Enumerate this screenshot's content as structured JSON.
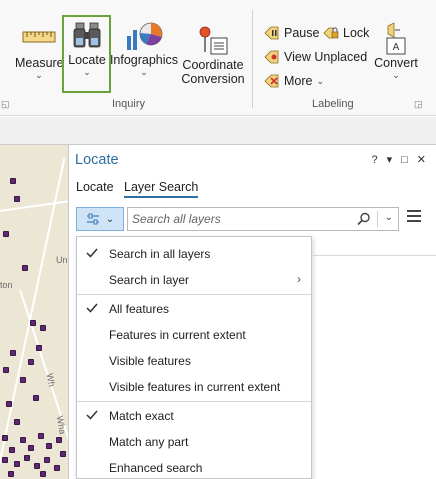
{
  "ribbon": {
    "inquiry": {
      "buttons": [
        {
          "label": "Measure",
          "icon": "ruler-icon"
        },
        {
          "label": "Locate",
          "icon": "binoculars-icon"
        },
        {
          "label": "Infographics",
          "icon": "pie-chart-icon"
        },
        {
          "label_line1": "Coordinate",
          "label_line2": "Conversion",
          "icon": "coordinate-conversion-icon"
        }
      ],
      "group_label": "Inquiry"
    },
    "labeling": {
      "pause_label": "Pause",
      "lock_label": "Lock",
      "view_unplaced_label": "View Unplaced",
      "more_label": "More",
      "convert_label": "Convert",
      "group_label": "Labeling"
    }
  },
  "map": {
    "labels": [
      "Un",
      "ton",
      "Wh",
      "Wha"
    ]
  },
  "pane": {
    "title": "Locate",
    "controls": [
      "?",
      "▾",
      "□",
      "✕"
    ],
    "tabs": [
      {
        "label": "Locate",
        "active": false
      },
      {
        "label": "Layer Search",
        "active": true
      }
    ],
    "search": {
      "placeholder": "Search all layers",
      "value": ""
    }
  },
  "menu": {
    "sections": [
      {
        "items": [
          {
            "label": "Search in all layers",
            "checked": true
          },
          {
            "label": "Search in layer",
            "checked": false,
            "submenu": true
          }
        ]
      },
      {
        "items": [
          {
            "label": "All features",
            "checked": true
          },
          {
            "label": "Features in current extent",
            "checked": false
          },
          {
            "label": "Visible features",
            "checked": false
          },
          {
            "label": "Visible features in current extent",
            "checked": false
          }
        ]
      },
      {
        "items": [
          {
            "label": "Match exact",
            "checked": true
          },
          {
            "label": "Match any part",
            "checked": false
          },
          {
            "label": "Enhanced search",
            "checked": false
          }
        ]
      }
    ]
  },
  "colors": {
    "accent": "#2e6f9e",
    "locate_highlight": "#6aa33c",
    "map_points": "#5d2a6f",
    "map_background": "#ece6d5"
  }
}
